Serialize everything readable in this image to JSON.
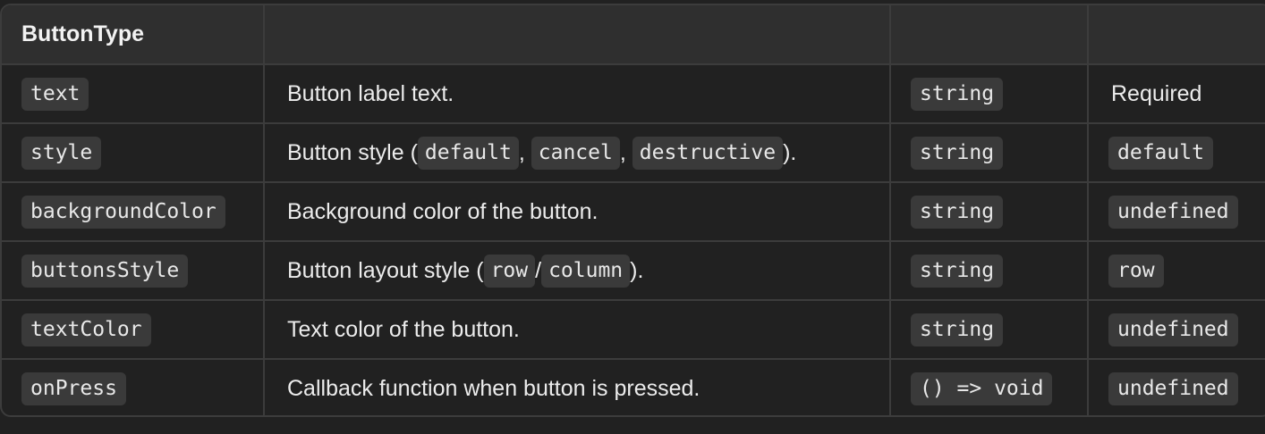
{
  "table": {
    "title": "ButtonType",
    "rows": [
      {
        "name": "text",
        "description": "Button label text.",
        "type": "string",
        "default": "Required"
      },
      {
        "name": "style",
        "description_parts": {
          "prefix": "Button style (",
          "opt1": "default",
          "sep1": ",",
          "opt2": "cancel",
          "sep2": ",",
          "opt3": "destructive",
          "suffix": ")."
        },
        "type": "string",
        "default": "default"
      },
      {
        "name": "backgroundColor",
        "description": "Background color of the button.",
        "type": "string",
        "default": "undefined"
      },
      {
        "name": "buttonsStyle",
        "description_parts": {
          "prefix": "Button layout style (",
          "opt1": "row",
          "sep1": "/",
          "opt2": "column",
          "suffix": ")."
        },
        "type": "string",
        "default": "row"
      },
      {
        "name": "textColor",
        "description": "Text color of the button.",
        "type": "string",
        "default": "undefined"
      },
      {
        "name": "onPress",
        "description": "Callback function when button is pressed.",
        "type": "() => void",
        "default": "undefined"
      }
    ]
  },
  "colors": {
    "background": "#212121",
    "header_background": "#2f2f2f",
    "border": "#3c3c3c",
    "code_background": "#3a3a3a"
  }
}
